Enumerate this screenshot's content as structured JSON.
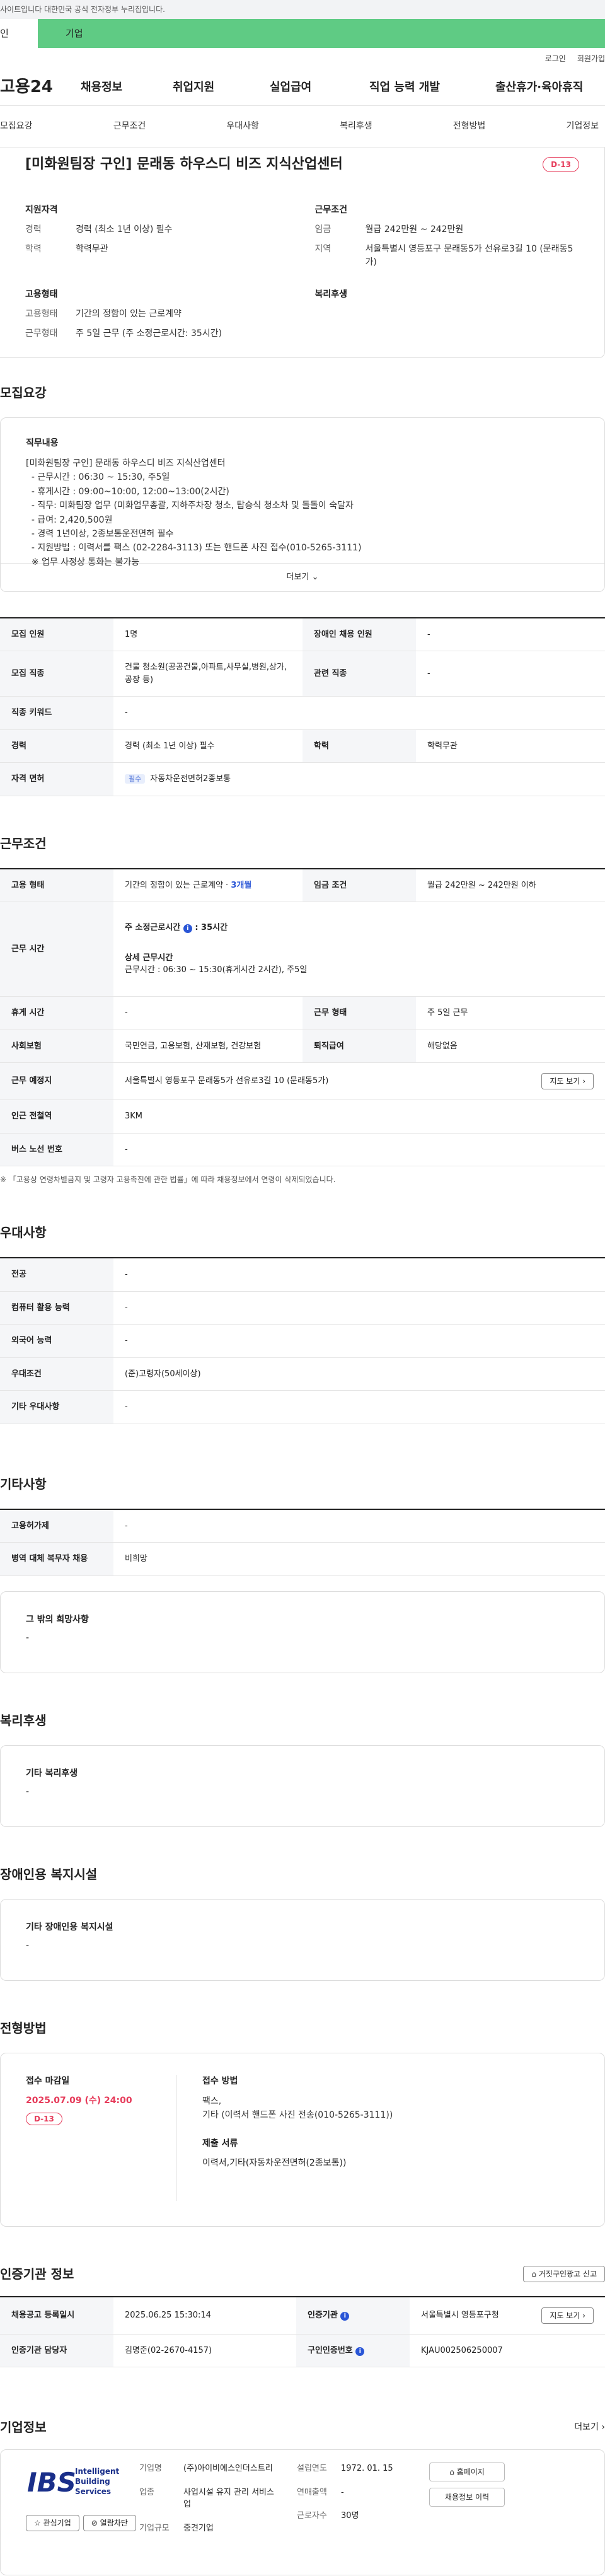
{
  "gov_notice": "사이트입니다 대한민국 공식 전자정부 누리집입니다.",
  "top_tabs": {
    "personal": "인",
    "company": "기업"
  },
  "util_links": [
    "로그인",
    "회원가입"
  ],
  "logo": "고용24",
  "gnb": [
    "채용정보",
    "취업지원",
    "실업급여",
    "직업 능력 개발",
    "출산휴가·육아휴직"
  ],
  "lnb": [
    "모집요강",
    "근무조건",
    "우대사항",
    "복리후생",
    "전형방법",
    "기업정보"
  ],
  "job": {
    "title": "[미화원팀장 구인] 문래동 하우스디 비즈 지식산업센터",
    "dday": "D-13",
    "qualification_heading": "지원자격",
    "qual": [
      {
        "k": "경력",
        "v": "경력 (최소 1년 이상) 필수"
      },
      {
        "k": "학력",
        "v": "학력무관"
      }
    ],
    "condition_heading": "근무조건",
    "cond": [
      {
        "k": "임금",
        "v": "월급 242만원 ~ 242만원"
      },
      {
        "k": "지역",
        "v": "서울특별시 영등포구 문래동5가 선유로3길 10 (문래동5가)"
      }
    ],
    "employment_heading": "고용형태",
    "emp": [
      {
        "k": "고용형태",
        "v": "기간의 정함이 있는 근로계약"
      },
      {
        "k": "근무형태",
        "v": "주 5일 근무 (주 소정근로시간: 35시간)"
      }
    ],
    "welfare_heading": "복리후생"
  },
  "recruit": {
    "title": "모집요강",
    "duties_heading": "직무내용",
    "duties_text": "[미화원팀장 구인] 문래동 하우스디 비즈 지식산업센터\n  - 근무시간 : 06:30 ~ 15:30, 주5일\n  - 휴게시간 : 09:00~10:00, 12:00~13:00(2시간)\n  - 직무: 미화팀장 업무 (미화업무총괄, 지하주차장 청소, 탑승식 청소차 및 돌돌이 숙달자\n  - 급여: 2,420,500원\n  - 경력 1년이상, 2종보통운전면허 필수\n  - 지원방법 : 이력서를 팩스 (02-2284-3113) 또는 핸드폰 사진 접수(010-5265-3111)\n  ※ 업무 사정상 통화는 불가능",
    "more": "더보기",
    "table": {
      "r1": [
        "모집 인원",
        "1명",
        "장애인 채용 인원",
        "-"
      ],
      "r2": [
        "모집 직종",
        "건물 청소원(공공건물,아파트,사무실,병원,상가,공장 등)",
        "관련 직종",
        "-"
      ],
      "r3": [
        "직종 키워드",
        "-"
      ],
      "r4": [
        "경력",
        "경력 (최소 1년 이상) 필수",
        "학력",
        "학력무관"
      ],
      "r5_k": "자격 면허",
      "r5_badge": "필수",
      "r5_v": "자동차운전면허2종보통"
    }
  },
  "work": {
    "title": "근무조건",
    "r1": [
      "고용 형태",
      "기간의 정함이 있는 근로계약",
      "3개월",
      "임금 조건",
      "월급 242만원 ~ 242만원 이하"
    ],
    "hours_k": "근무 시간",
    "hours_weekly_label": "주 소정근로시간",
    "hours_weekly_value": ": 35시간",
    "hours_detail_label": "상세 근무시간",
    "hours_detail_value": "근무시간 : 06:30 ~ 15:30(휴게시간 2시간), 주5일",
    "r3": [
      "휴게 시간",
      "-",
      "근무 형태",
      "주 5일 근무"
    ],
    "r4": [
      "사회보험",
      "국민연금, 고용보험, 산재보험, 건강보험",
      "퇴직급여",
      "해당없음"
    ],
    "r5": [
      "근무 예정지",
      "서울특별시 영등포구 문래동5가 선유로3길 10 (문래동5가)"
    ],
    "map_button": "지도 보기",
    "r6": [
      "인근 전철역",
      "3KM"
    ],
    "r7": [
      "버스 노선 번호",
      "-"
    ],
    "note": "※ 「고용상 연령차별금지 및 고령자 고용촉진에 관한 법률」에 따라 채용정보에서 연령이 삭제되었습니다."
  },
  "pref": {
    "title": "우대사항",
    "rows": [
      [
        "전공",
        "-"
      ],
      [
        "컴퓨터 활용 능력",
        "-"
      ],
      [
        "외국어 능력",
        "-"
      ],
      [
        "우대조건",
        "(준)고령자(50세이상)"
      ],
      [
        "기타 우대사항",
        "-"
      ]
    ]
  },
  "etc": {
    "title": "기타사항",
    "rows": [
      [
        "고용허가제",
        "-"
      ],
      [
        "병역 대체 복무자 채용",
        "비희망"
      ]
    ],
    "other_heading": "그 밖의 희망사항",
    "other_value": "-"
  },
  "welfare": {
    "title": "복리후생",
    "heading": "기타 복리후생",
    "value": "-"
  },
  "disability": {
    "title": "장애인용 복지시설",
    "heading": "기타 장애인용 복지시설",
    "value": "-"
  },
  "screening": {
    "title": "전형방법",
    "deadline_heading": "접수 마감일",
    "deadline": "2025.07.09 (수) 24:00",
    "dday": "D-13",
    "method_heading": "접수 방법",
    "method_value": "팩스,\n기타 (이력서 핸드폰 사진 전송(010-5265-3111))",
    "docs_heading": "제출 서류",
    "docs_value": "이력서,기타(자동차운전면허(2종보통))"
  },
  "agency": {
    "title": "인증기관 정보",
    "report_button": "거짓구인광고 신고",
    "r1": [
      "채용공고 등록일시",
      "2025.06.25 15:30:14",
      "인증기관",
      "서울특별시 영등포구청"
    ],
    "map_button": "지도 보기",
    "r2": [
      "인증기관 담당자",
      "김명준(02-2670-4157)",
      "구인인증번호",
      "KJAU002506250007"
    ]
  },
  "company": {
    "title": "기업정보",
    "more": "더보기",
    "logo_text": [
      "Intelligent",
      "Building",
      "Services"
    ],
    "logo_mark": "IBS",
    "fav_button": "관심기업",
    "block_button": "열람차단",
    "col1": [
      [
        "기업명",
        "(주)아이비에스인더스트리"
      ],
      [
        "업종",
        "사업시설 유지 관리 서비스업"
      ],
      [
        "기업규모",
        "중견기업"
      ]
    ],
    "col2": [
      [
        "설립연도",
        "1972. 01. 15"
      ],
      [
        "연매출액",
        "-"
      ],
      [
        "근로자수",
        "30명"
      ]
    ],
    "home_button": "홈페이지",
    "jobs_button": "채용정보 이력"
  },
  "colors": {
    "accent_green": "#5fcb84",
    "dday_red": "#e63b5a",
    "info_blue": "#2a56d6"
  }
}
